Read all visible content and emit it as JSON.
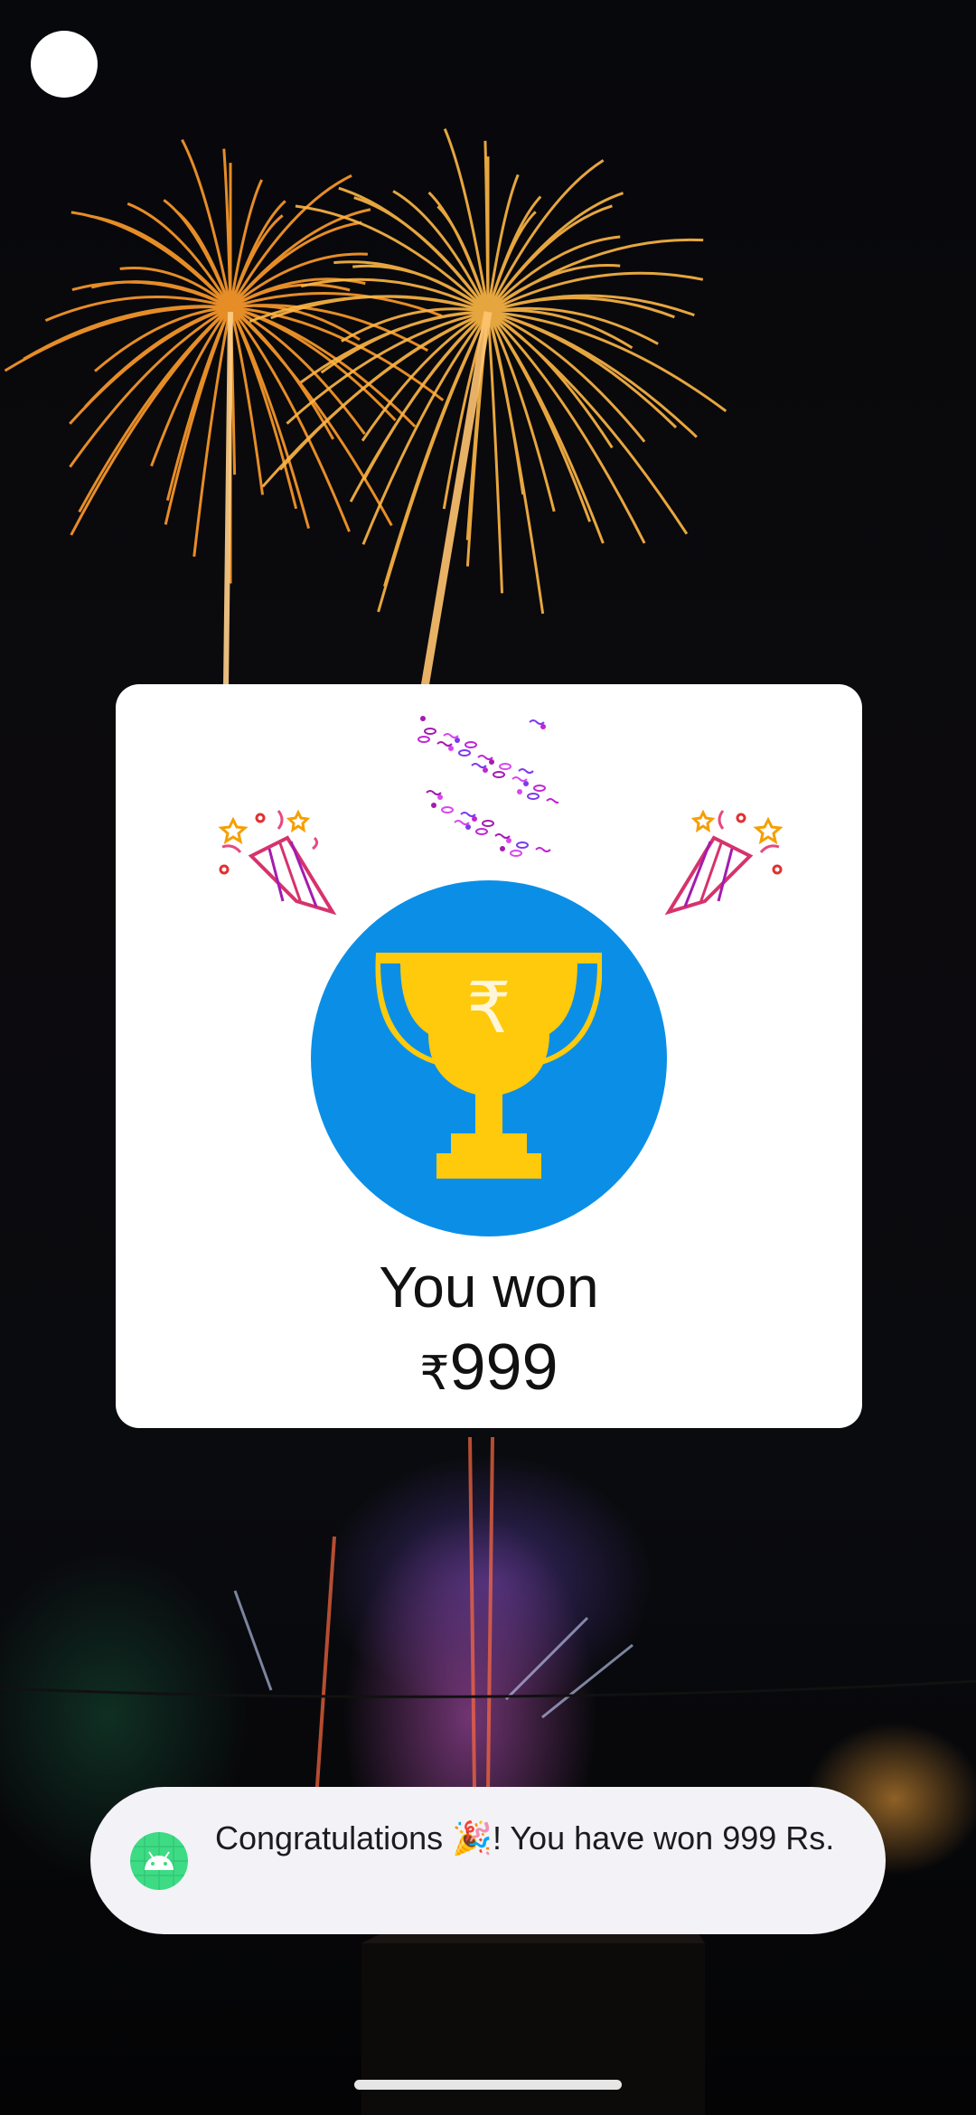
{
  "card": {
    "title": "You won",
    "currency": "₹",
    "amount": "999"
  },
  "trophy": {
    "symbol": "₹",
    "circle_color": "#0B8FE6",
    "cup_color": "#FFC90C"
  },
  "toast": {
    "message": "Congratulations 🎉! You have won 999 Rs."
  },
  "icons": {
    "left_popper": "party-popper-icon",
    "right_popper": "party-popper-icon",
    "confetti": "confetti-icon",
    "toast_app": "android-app-icon"
  }
}
